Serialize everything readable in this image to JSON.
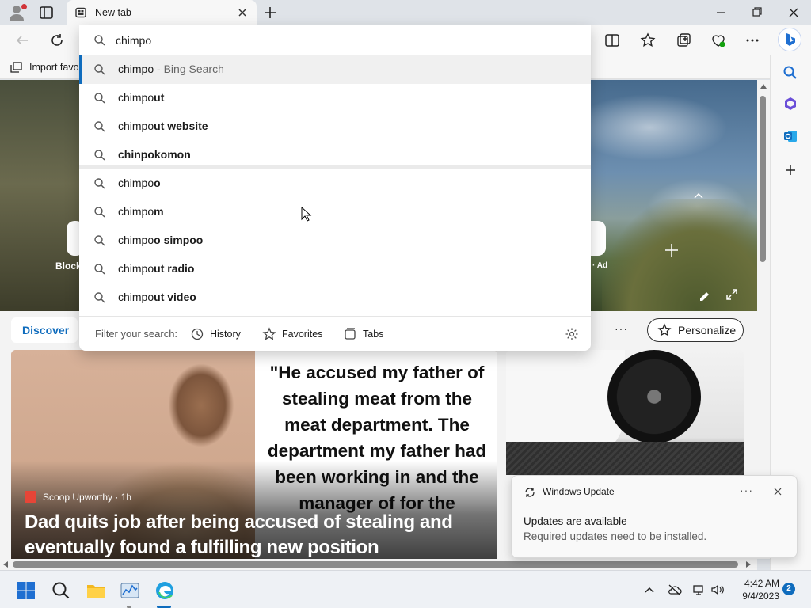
{
  "browser": {
    "tab_title": "New tab",
    "favorites_bar_item": "Import favo"
  },
  "omnibox": {
    "value": "chimpo",
    "suggestions": [
      {
        "prefix": "chimpo",
        "bold": "",
        "tail": " - Bing Search"
      },
      {
        "prefix": "chimpo",
        "bold": "ut",
        "tail": ""
      },
      {
        "prefix": "chimpo",
        "bold": "ut website",
        "tail": ""
      },
      {
        "prefix": "",
        "bold": "chinpokomon",
        "tail": ""
      },
      {
        "prefix": "chimpo",
        "bold": "o",
        "tail": ""
      },
      {
        "prefix": "chimpo",
        "bold": "m",
        "tail": ""
      },
      {
        "prefix": "chimpo",
        "bold": "o simpoo",
        "tail": ""
      },
      {
        "prefix": "chimpo",
        "bold": "ut radio",
        "tail": ""
      },
      {
        "prefix": "chimpo",
        "bold": "ut video",
        "tail": ""
      }
    ],
    "filter_label": "Filter your search:",
    "filters": {
      "history": "History",
      "favorites": "Favorites",
      "tabs": "Tabs"
    }
  },
  "newtab": {
    "quick_link_left_label": "Block",
    "quick_link_right_label": "· Ad",
    "discover_tab": "Discover",
    "more": "···",
    "personalize": "Personalize",
    "card1": {
      "quote": "\"He accused my father of stealing meat from the meat department. The department my father had been working in and the manager of for the",
      "source": "Scoop Upworthy · 1h",
      "headline": "Dad quits job after being accused of stealing and eventually found a fulfilling new position"
    }
  },
  "notification": {
    "app": "Windows Update",
    "more": "···",
    "title": "Updates are available",
    "body": "Required updates need to be installed."
  },
  "taskbar": {
    "time": "4:42 AM",
    "date": "9/4/2023",
    "notification_count": "2"
  },
  "colors": {
    "accent": "#0f6cbd",
    "titlebar": "#dfe3e8",
    "toolbar": "#f7f7f7"
  }
}
